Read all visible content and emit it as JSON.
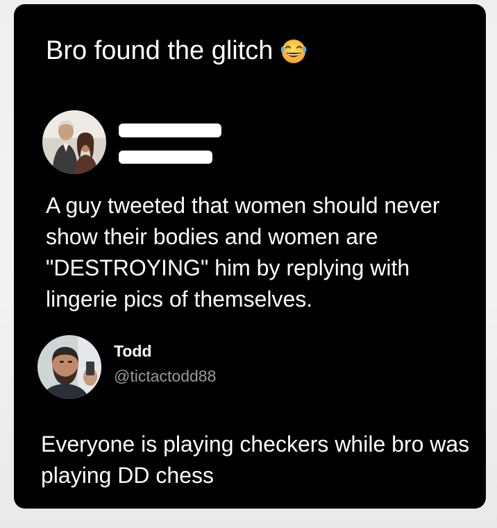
{
  "post": {
    "title": "Bro found the glitch",
    "title_emoji": "face-with-tears-of-joy",
    "background": "#000000"
  },
  "first_tweet": {
    "author_name": "",
    "author_handle": "",
    "redacted": true,
    "text": "A guy tweeted that women should never show their bodies and women are \"DESTROYING\" him by replying with lingerie pics of themselves."
  },
  "second_tweet": {
    "author_name": "Todd",
    "author_handle": "@tictactodd88",
    "text": "Everyone is playing checkers while bro was playing DD chess"
  }
}
